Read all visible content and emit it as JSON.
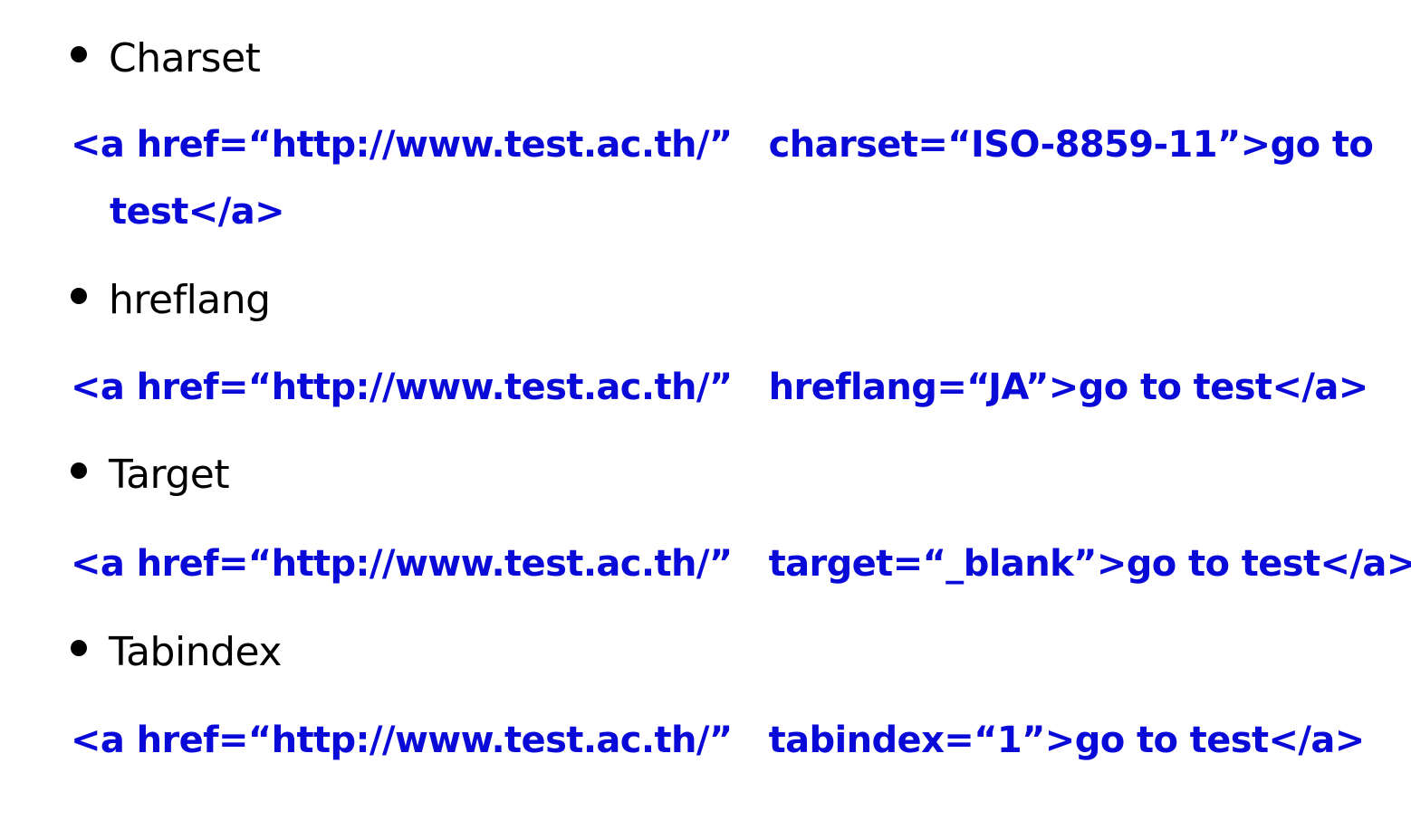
{
  "colors": {
    "code_text": "#0a0ad8",
    "bullet_text": "#000000",
    "background": "#ffffff"
  },
  "items": [
    {
      "label": "Charset",
      "code_lines": [
        "<a href=“http://www.test.ac.th/”   charset=“ISO-8859-11”>go to",
        "test</a>"
      ]
    },
    {
      "label": "hreflang",
      "code_lines": [
        "<a href=“http://www.test.ac.th/”   hreflang=“JA”>go to test</a>"
      ]
    },
    {
      "label": "Target",
      "code_lines": [
        "<a href=“http://www.test.ac.th/”   target=“_blank”>go to test</a>"
      ]
    },
    {
      "label": "Tabindex",
      "code_lines": [
        "<a href=“http://www.test.ac.th/”   tabindex=“1”>go to test</a>"
      ]
    }
  ]
}
